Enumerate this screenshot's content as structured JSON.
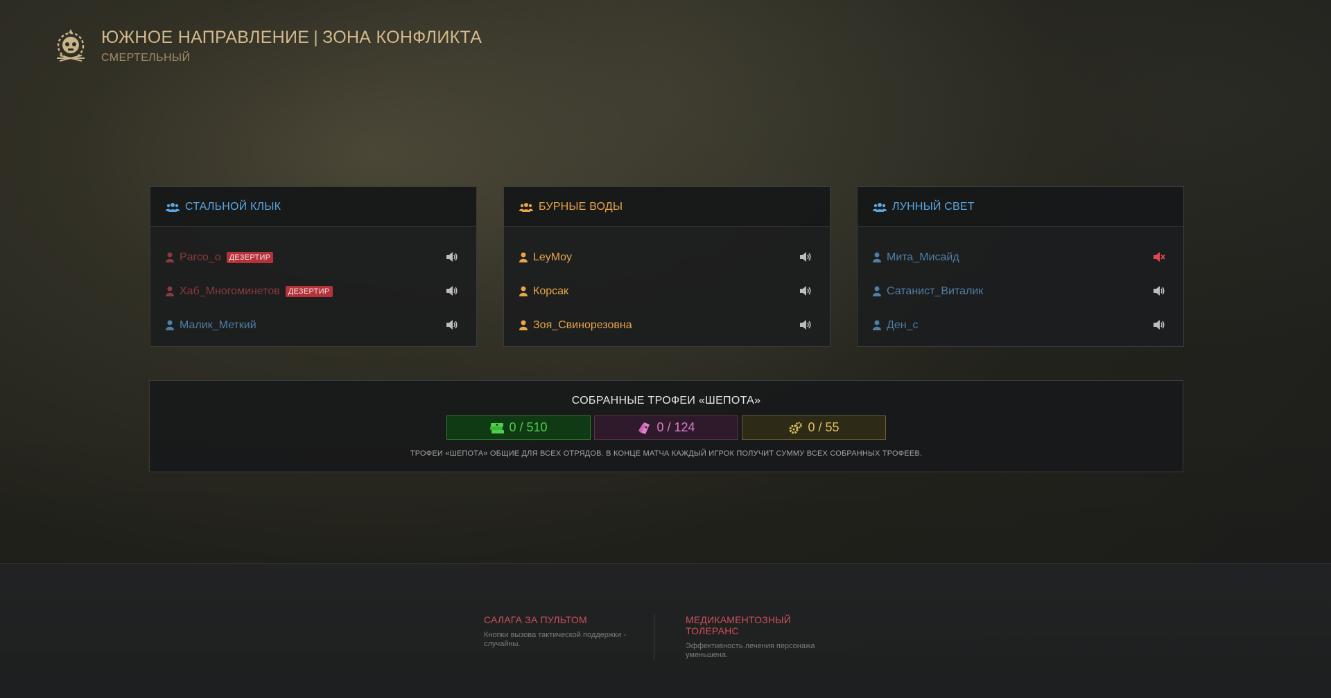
{
  "header": {
    "title_left": "ЮЖНОЕ НАПРАВЛЕНИЕ",
    "title_sep": "|",
    "title_right": "ЗОНА КОНФЛИКТА",
    "difficulty": "СМЕРТЕЛЬНЫЙ",
    "emblem_icon": "skull-gear-emblem-icon"
  },
  "squads": [
    {
      "name": "СТАЛЬНОЙ КЛЫК",
      "color": "#5aa6e0",
      "members": [
        {
          "name": "Parco_o",
          "badge": "ДЕЗЕРТИР",
          "color": "#8a3a3e",
          "muted": false
        },
        {
          "name": "Хаб_Многоминетов",
          "badge": "ДЕЗЕРТИР",
          "color": "#8a3a3e",
          "muted": false
        },
        {
          "name": "Малик_Меткий",
          "badge": "",
          "color": "#4f7fa6",
          "muted": false
        }
      ]
    },
    {
      "name": "БУРНЫЕ ВОДЫ",
      "color": "#e8a54a",
      "members": [
        {
          "name": "LeyMoy",
          "badge": "",
          "color": "#e8a54a",
          "muted": false
        },
        {
          "name": "Корсак",
          "badge": "",
          "color": "#e8a54a",
          "muted": false
        },
        {
          "name": "Зоя_Свинорезовна",
          "badge": "",
          "color": "#e8a54a",
          "muted": false
        }
      ]
    },
    {
      "name": "ЛУННЫЙ СВЕТ",
      "color": "#5aa6e0",
      "members": [
        {
          "name": "Мита_Мисайд",
          "badge": "",
          "color": "#4f7fa6",
          "muted": true
        },
        {
          "name": "Сатанист_Виталик",
          "badge": "",
          "color": "#4f7fa6",
          "muted": false
        },
        {
          "name": "Ден_с",
          "badge": "",
          "color": "#4f7fa6",
          "muted": false
        }
      ]
    }
  ],
  "trophies": {
    "title": "СОБРАННЫЕ ТРОФЕИ «ШЕПОТА»",
    "meters": [
      {
        "value": "0 / 510",
        "icon": "cash-stack-icon",
        "color": "#4fd04d"
      },
      {
        "value": "0 / 124",
        "icon": "tickets-icon",
        "color": "#e07fcd"
      },
      {
        "value": "0 / 55",
        "icon": "gears-icon",
        "color": "#e0c35c"
      }
    ],
    "note": "ТРОФЕИ «ШЕПОТА» ОБЩИЕ ДЛЯ ВСЕХ ОТРЯДОВ. В КОНЦЕ МАТЧА КАЖДЫЙ ИГРОК ПОЛУЧИТ СУММУ ВСЕХ СОБРАННЫХ ТРОФЕЕВ."
  },
  "modifiers": [
    {
      "title": "САЛАГА ЗА ПУЛЬТОМ",
      "desc": "Кнопки вызова тактической поддержки - случайны."
    },
    {
      "title": "МЕДИКАМЕНТОЗНЫЙ ТОЛЕРАНС",
      "desc": "Эффективность лечения персонажа уменьшена."
    }
  ]
}
